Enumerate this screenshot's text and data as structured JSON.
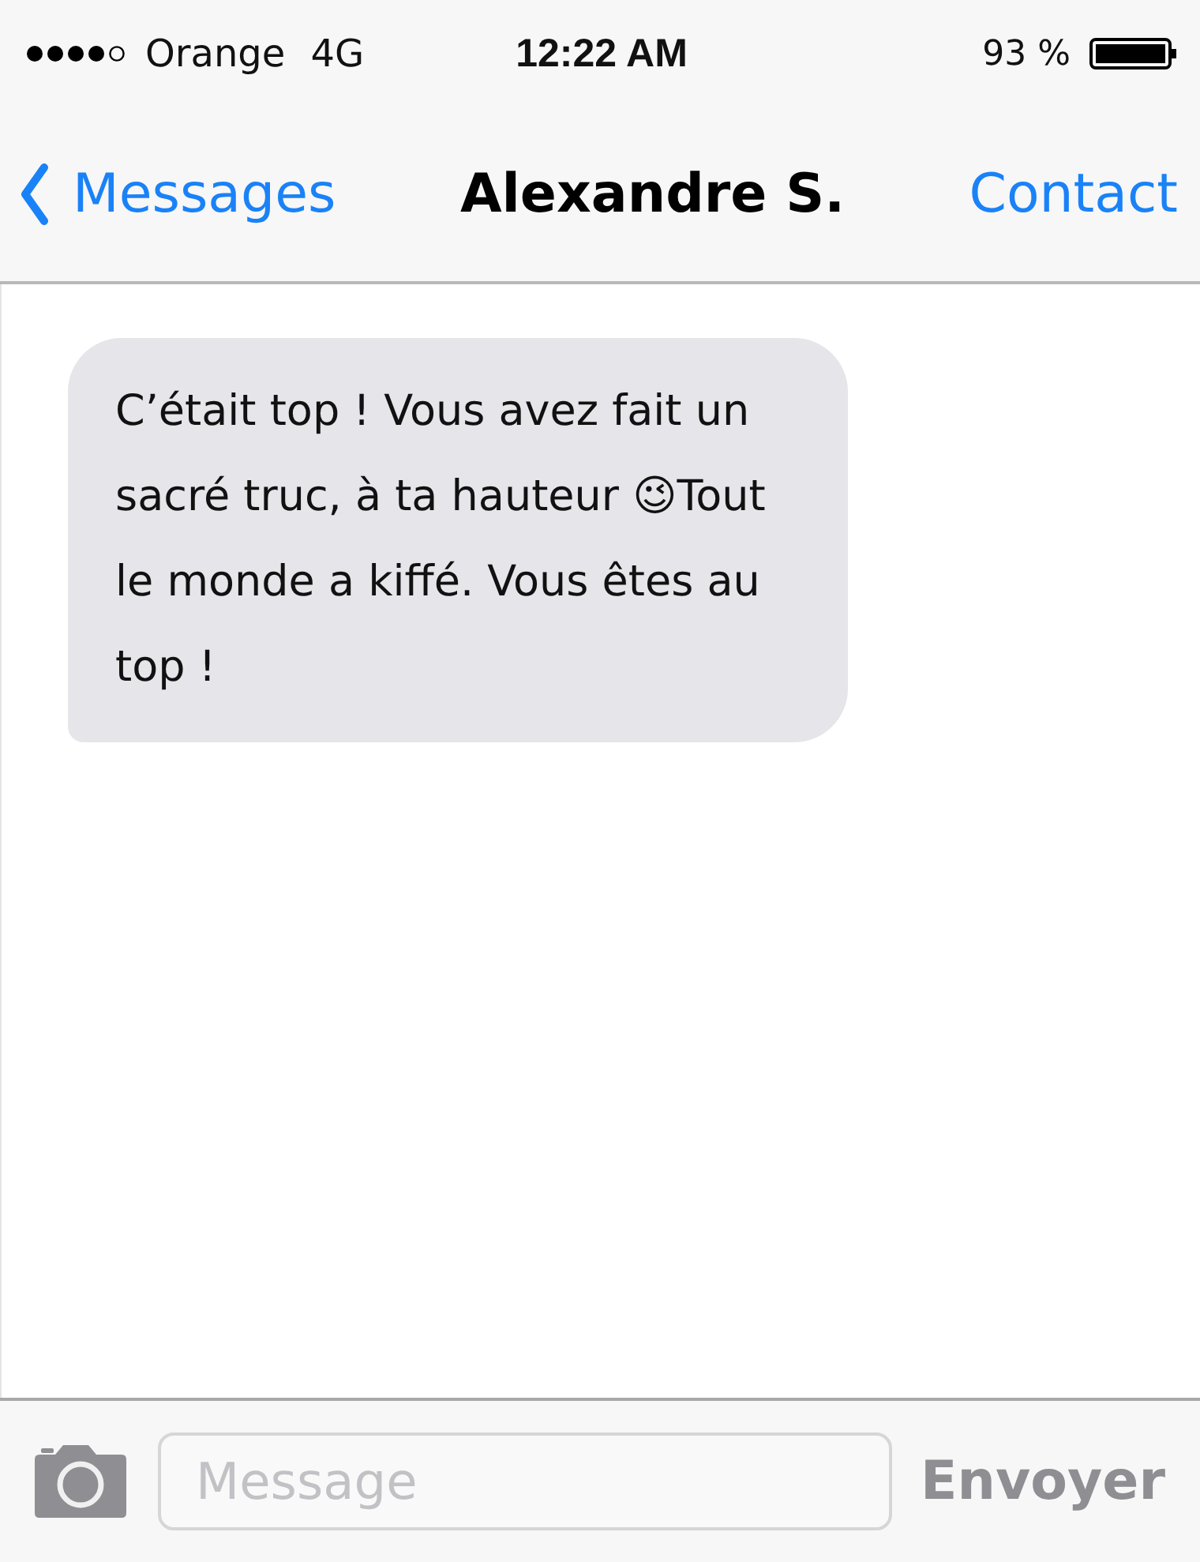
{
  "status_bar": {
    "carrier": "Orange",
    "network": "4G",
    "time": "12:22 AM",
    "battery": "93 %"
  },
  "nav": {
    "back": "Messages",
    "title": "Alexandre S.",
    "action": "Contact"
  },
  "messages": [
    {
      "kind": "incoming",
      "text": "C’était top ! Vous avez fait un sacré truc, à ta hauteur 😉Tout le monde a kiffé. Vous êtes au top !"
    }
  ],
  "composer": {
    "placeholder": "Message",
    "send": "Envoyer"
  }
}
